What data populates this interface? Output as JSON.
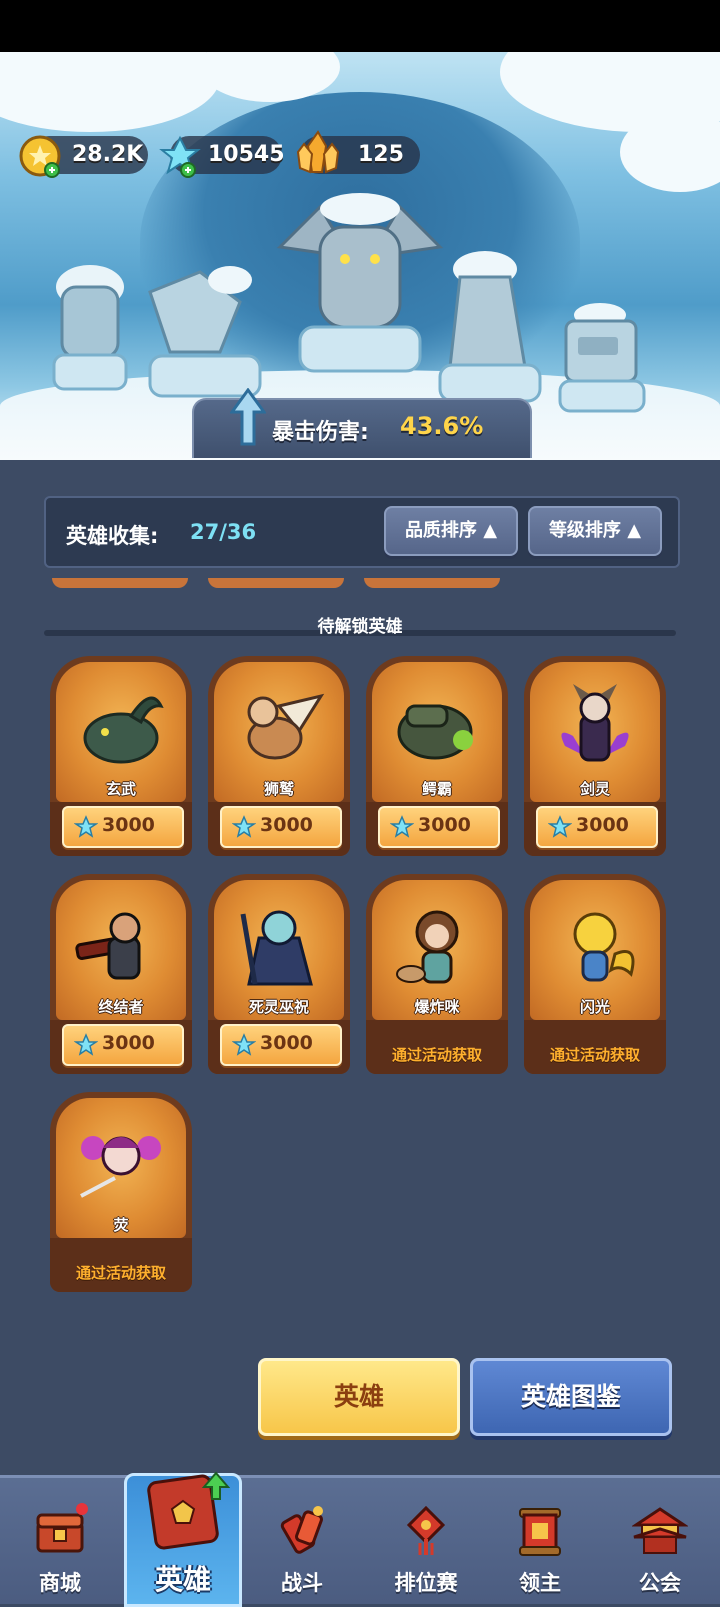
{
  "resources": {
    "gold": "28.2K",
    "diamond": "10545",
    "crystal": "125"
  },
  "crit": {
    "label": "暴击伤害:",
    "value": "43.6%"
  },
  "collection": {
    "label": "英雄收集:",
    "value": "27/36",
    "sort_quality": "品质排序",
    "sort_level": "等级排序"
  },
  "section_title": "待解锁英雄",
  "heroes": [
    {
      "name": "玄武",
      "price": "3000"
    },
    {
      "name": "狮鹫",
      "price": "3000"
    },
    {
      "name": "鳄霸",
      "price": "3000"
    },
    {
      "name": "剑灵",
      "price": "3000"
    },
    {
      "name": "终结者",
      "price": "3000"
    },
    {
      "name": "死灵巫祝",
      "price": "3000"
    },
    {
      "name": "爆炸咪",
      "event": "通过活动获取"
    },
    {
      "name": "闪光",
      "event": "通过活动获取"
    },
    {
      "name": "荧",
      "event": "通过活动获取"
    }
  ],
  "buttons": {
    "heroes": "英雄",
    "codex": "英雄图鉴"
  },
  "nav": {
    "shop": "商城",
    "heroes": "英雄",
    "battle": "战斗",
    "ranked": "排位赛",
    "lord": "领主",
    "guild": "公会"
  },
  "colors": {
    "panel": "#3d4b64",
    "accent_gold": "#ffd54a",
    "accent_cyan": "#7ee0f4",
    "card_orange": "#df8c33",
    "event_text": "#ffb02e"
  }
}
